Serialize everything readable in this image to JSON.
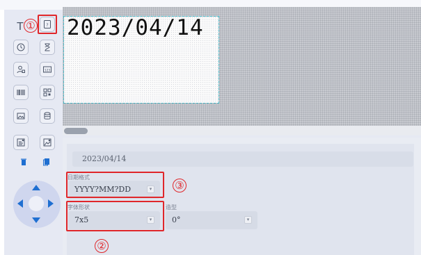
{
  "canvas": {
    "print_text": "2023/04/14"
  },
  "properties": {
    "content_value": "2023/04/14",
    "date_format": {
      "label": "日期格式",
      "value": "YYYY?MM?DD"
    },
    "font_shape": {
      "label": "字体形状",
      "value": "7x5"
    },
    "rotation": {
      "label": "造型",
      "value": "0°"
    }
  },
  "annotations": {
    "marker1": "①",
    "marker2": "②",
    "marker3": "③"
  },
  "toolbox": {
    "icons": [
      "text-icon",
      "date-field-icon",
      "clock-icon",
      "hourglass-icon",
      "user-icon",
      "counter-icon",
      "barcode-icon",
      "qr-code-icon",
      "image-icon",
      "database-icon",
      "document-icon",
      "graphic-icon",
      "delete-icon",
      "copy-icon"
    ],
    "text_tool_glyph": "T"
  },
  "colors": {
    "accent_red": "#e0262a",
    "dpad": "#cfd6ee",
    "selection_outline": "#47b9c8"
  }
}
